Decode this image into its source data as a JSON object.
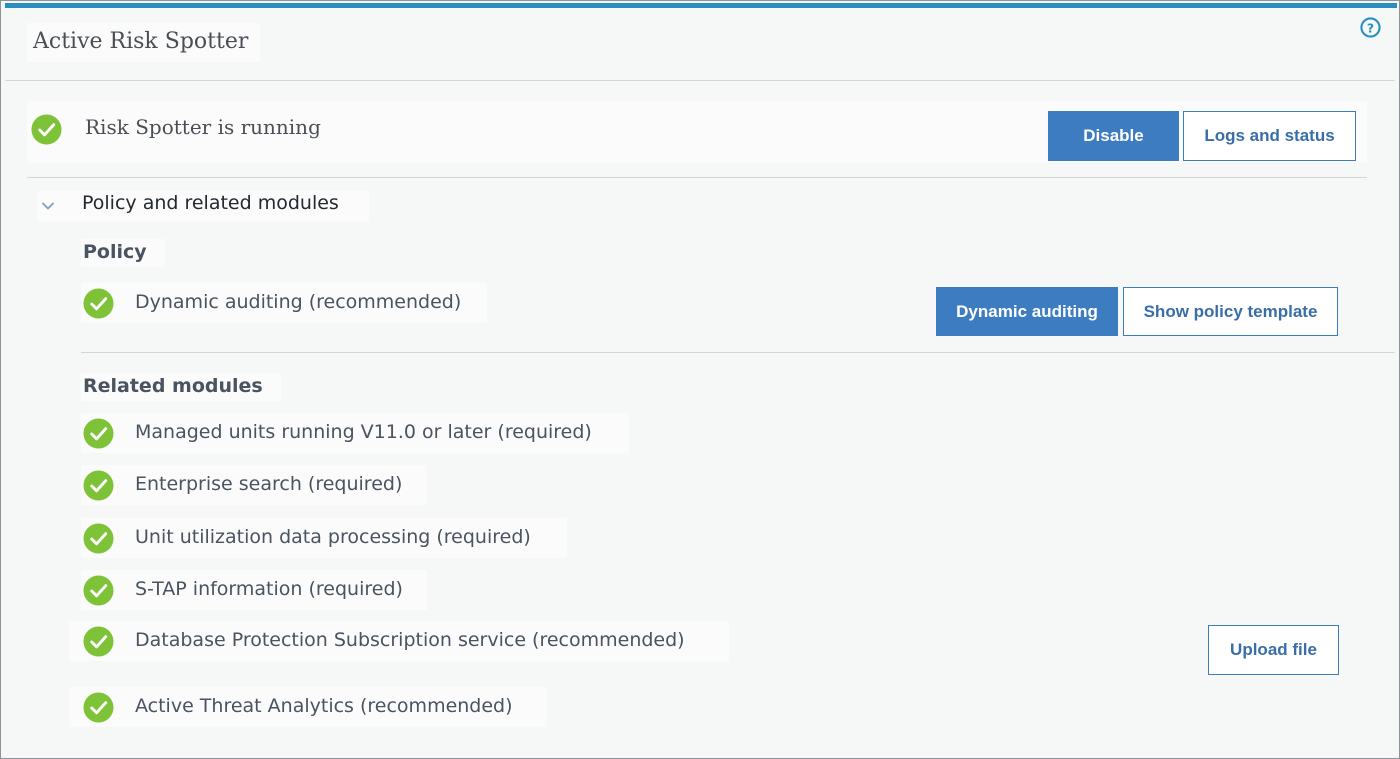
{
  "header": {
    "title": "Active Risk Spotter",
    "help_icon": "help-circle-icon",
    "accent_color": "#2a8fc0"
  },
  "status": {
    "text": "Risk Spotter is running",
    "icon": "check-circle-icon",
    "icon_color": "#7ec238",
    "disable_label": "Disable",
    "logs_label": "Logs and status"
  },
  "section": {
    "toggle_label": "Policy and related modules",
    "expanded": true
  },
  "policy": {
    "heading": "Policy",
    "item_label": "Dynamic auditing (recommended)",
    "dynamic_auditing_label": "Dynamic auditing",
    "show_template_label": "Show policy template"
  },
  "modules": {
    "heading": "Related modules",
    "items": [
      {
        "label": "Managed units running V11.0 or later (required)"
      },
      {
        "label": "Enterprise search (required)"
      },
      {
        "label": "Unit utilization data processing (required)"
      },
      {
        "label": "S-TAP information (required)"
      },
      {
        "label": "Database Protection Subscription service (recommended)"
      },
      {
        "label": "Active Threat Analytics (recommended)"
      }
    ],
    "upload_label": "Upload file"
  },
  "colors": {
    "primary_button": "#3e7cc2",
    "check_green": "#7ec238"
  }
}
